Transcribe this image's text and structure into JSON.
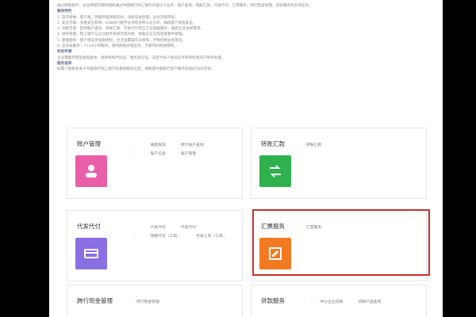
{
  "intro": {
    "lines": [
      {
        "type": "p",
        "text": "通过网络银行，企业网络可随时随地通过中国银行网上银行办理以下业务：账户查询、转账汇款、代发代付、汇票服务、跨行现金管理、贷款服务等多项业务。"
      },
      {
        "type": "h",
        "text": "服务特色"
      },
      {
        "type": "p",
        "text": "1. 操作便捷：客户端、网银界面清晰友好，功能布局合理，业务流程简单，"
      },
      {
        "type": "p",
        "text": "2. 安全可靠：多重安全机制，USBKEY数字证书等多种认证方式，确保客户资金安全。"
      },
      {
        "type": "p",
        "text": "3. 功能丰富：提供账户查询、转账汇款、代发代付等全方位金融服务，满足企业多样需求。"
      },
      {
        "type": "p",
        "text": "4. 财务管理：网上银行与企业财务系统无缝对接，帮助企业实现资金集中管理。"
      },
      {
        "type": "p",
        "text": "5. 管理授权：客户端支持多级授权，灵活设置操作员权限，严格控制业务风险。"
      },
      {
        "type": "p",
        "text": "6. 全天候服务：7×24小时服务，随时随地办理业务，不受时间地域限制。"
      },
      {
        "type": "h",
        "text": "如何申请"
      },
      {
        "type": "p",
        "text": "企业需携带营业执照副本、组织机构代码证、税务登记证、法定代表人身份证件等资料到开户网点办理。"
      },
      {
        "type": "h",
        "text": "服务指导"
      },
      {
        "type": "p",
        "text": "如需了解更多关于中国银行网上银行的相关服务信息，请致电中国银行客户服务热线95566咨询。"
      }
    ]
  },
  "cards": [
    {
      "title": "账户管理",
      "color": "#e95fa8",
      "icon": "user-icon",
      "links": [
        [
          "基础查询",
          "账户信息"
        ],
        [
          "跨行账户查询",
          "账户管理"
        ]
      ]
    },
    {
      "title": "转账汇款",
      "color": "#2fb24d",
      "icon": "transfer-icon",
      "links": [
        [
          "转账汇款"
        ]
      ]
    },
    {
      "title": "代发代付",
      "color": "#8a6fe3",
      "icon": "card-icon",
      "links": [
        [
          "代发代付",
          "快捷代付（工资…"
        ],
        [
          "代发代付",
          "代发工资（工资…"
        ]
      ]
    },
    {
      "title": "汇票服务",
      "color": "#f47a22",
      "icon": "document-icon",
      "links": [
        [
          "汇票服务"
        ]
      ]
    },
    {
      "title": "跨行现金管理",
      "color": "#4a90e2",
      "icon": "cash-icon",
      "links": [
        [
          "跨行现金管理"
        ]
      ]
    },
    {
      "title": "贷款服务",
      "color": "#f0b429",
      "icon": "loan-icon",
      "links": [
        [
          "中小企业贷款",
          "贷款产品查询"
        ]
      ]
    }
  ]
}
